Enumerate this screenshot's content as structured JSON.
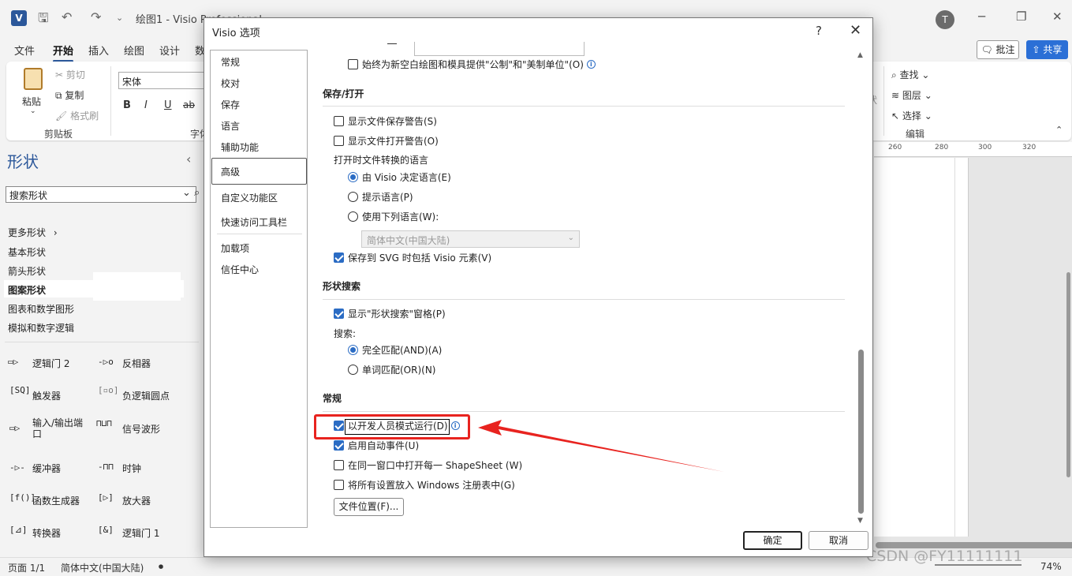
{
  "titlebar": {
    "logo": "V",
    "title": "绘图1 - Visio Professional",
    "avatar": "T"
  },
  "ribbon_tabs": [
    "文件",
    "开始",
    "插入",
    "绘图",
    "设计",
    "数"
  ],
  "ribbon_actions": {
    "comment": "批注",
    "share": "共享"
  },
  "ribbon": {
    "paste": "粘贴",
    "cut": "剪切",
    "copy": "复制",
    "format_painter": "格式刷",
    "clipboard_group": "剪贴板",
    "font_name": "宋体",
    "font_group": "字体",
    "find": "查找",
    "layer": "图层",
    "select": "选择",
    "edit_group": "编辑",
    "style_partial": "状"
  },
  "shapes_panel": {
    "title": "形状",
    "search_placeholder": "搜索形状",
    "more_shapes": "更多形状",
    "stencils": [
      "基本形状",
      "箭头形状",
      "图案形状",
      "图表和数学图形",
      "模拟和数字逻辑"
    ],
    "shapes": [
      {
        "label": "逻辑门 2",
        "icon": "gate-icon"
      },
      {
        "label": "反相器",
        "icon": "inverter-icon"
      },
      {
        "label": "触发器",
        "icon": "flipflop-icon"
      },
      {
        "label": "负逻辑圆点",
        "icon": "bubble-icon"
      },
      {
        "label": "输入/输出端口",
        "icon": "port-icon"
      },
      {
        "label": "信号波形",
        "icon": "waveform-icon"
      },
      {
        "label": "缓冲器",
        "icon": "buffer-icon"
      },
      {
        "label": "时钟",
        "icon": "clock-icon"
      },
      {
        "label": "函数生成器",
        "icon": "function-icon"
      },
      {
        "label": "放大器",
        "icon": "amplifier-icon"
      },
      {
        "label": "转换器",
        "icon": "converter-icon"
      },
      {
        "label": "逻辑门 1",
        "icon": "gate1-icon"
      }
    ]
  },
  "ruler": [
    "260",
    "280",
    "300",
    "320"
  ],
  "statusbar": {
    "page": "页面 1/1",
    "language": "简体中文(中国大陆)",
    "zoom": "74%"
  },
  "watermark": "CSDN @FY11111111",
  "dialog": {
    "title": "Visio 选项",
    "help": "?",
    "nav": [
      "常规",
      "校对",
      "保存",
      "语言",
      "辅助功能",
      "高级",
      "自定义功能区",
      "快速访问工具栏",
      "加载项",
      "信任中心"
    ],
    "selected_nav": "高级",
    "top_option": "始终为新空白绘图和模具提供\"公制\"和\"美制单位\"(O)",
    "save_open": {
      "heading": "保存/打开",
      "show_save_warning": "显示文件保存警告(S)",
      "show_open_warning": "显示文件打开警告(O)",
      "lang_heading": "打开时文件转换的语言",
      "radio_visio": "由 Visio 决定语言(E)",
      "radio_prompt": "提示语言(P)",
      "radio_use": "使用下列语言(W):",
      "lang_select": "简体中文(中国大陆)",
      "svg": "保存到 SVG 时包括 Visio 元素(V)"
    },
    "shape_search": {
      "heading": "形状搜索",
      "show_pane": "显示\"形状搜索\"窗格(P)",
      "search_label": "搜索:",
      "match_all": "完全匹配(AND)(A)",
      "match_any": "单词匹配(OR)(N)"
    },
    "general": {
      "heading": "常规",
      "dev_mode": "以开发人员模式运行(D)",
      "auto_events": "启用自动事件(U)",
      "shapesheet": "在同一窗口中打开每一 ShapeSheet (W)",
      "registry": "将所有设置放入 Windows 注册表中(G)",
      "file_locations": "文件位置(F)..."
    },
    "ok": "确定",
    "cancel": "取消"
  }
}
